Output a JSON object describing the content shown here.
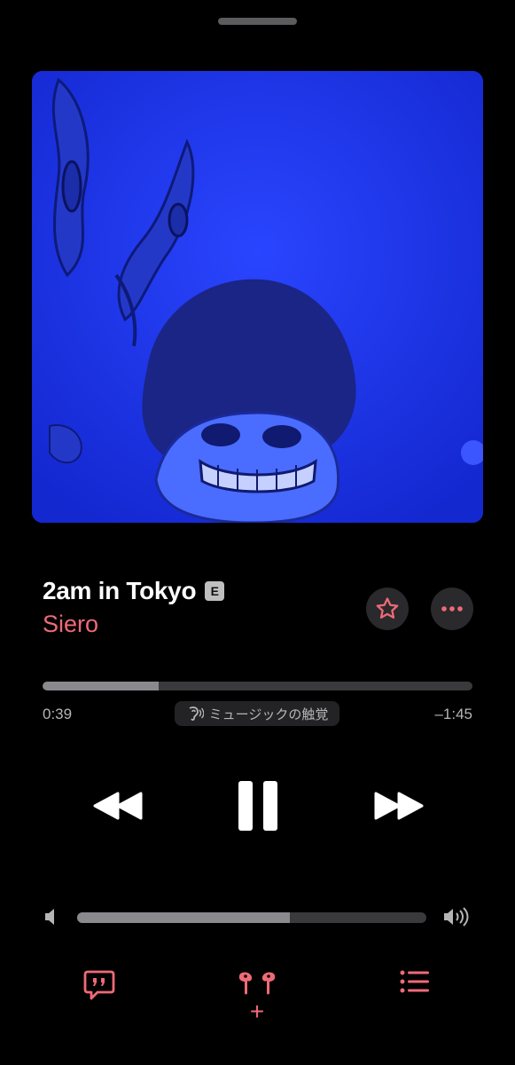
{
  "now_playing": {
    "title": "2am in Tokyo",
    "explicit_badge": "E",
    "artist": "Siero",
    "elapsed": "0:39",
    "remaining": "–1:45",
    "progress_fraction": 0.27,
    "haptics_label": "ミュージックの触覚",
    "volume_fraction": 0.61
  },
  "controls": {
    "favorite_icon": "star-icon",
    "more_icon": "ellipsis-icon",
    "rewind_icon": "backward-icon",
    "pause_icon": "pause-icon",
    "forward_icon": "forward-icon",
    "lyrics_icon": "lyrics-quote-bubble-icon",
    "airplay_icon": "airpods-icon",
    "airplay_plus": "+",
    "queue_icon": "list-icon"
  },
  "colors": {
    "accent": "#ef6a76",
    "background": "#000000",
    "artwork_blue": "#1c33e8"
  }
}
